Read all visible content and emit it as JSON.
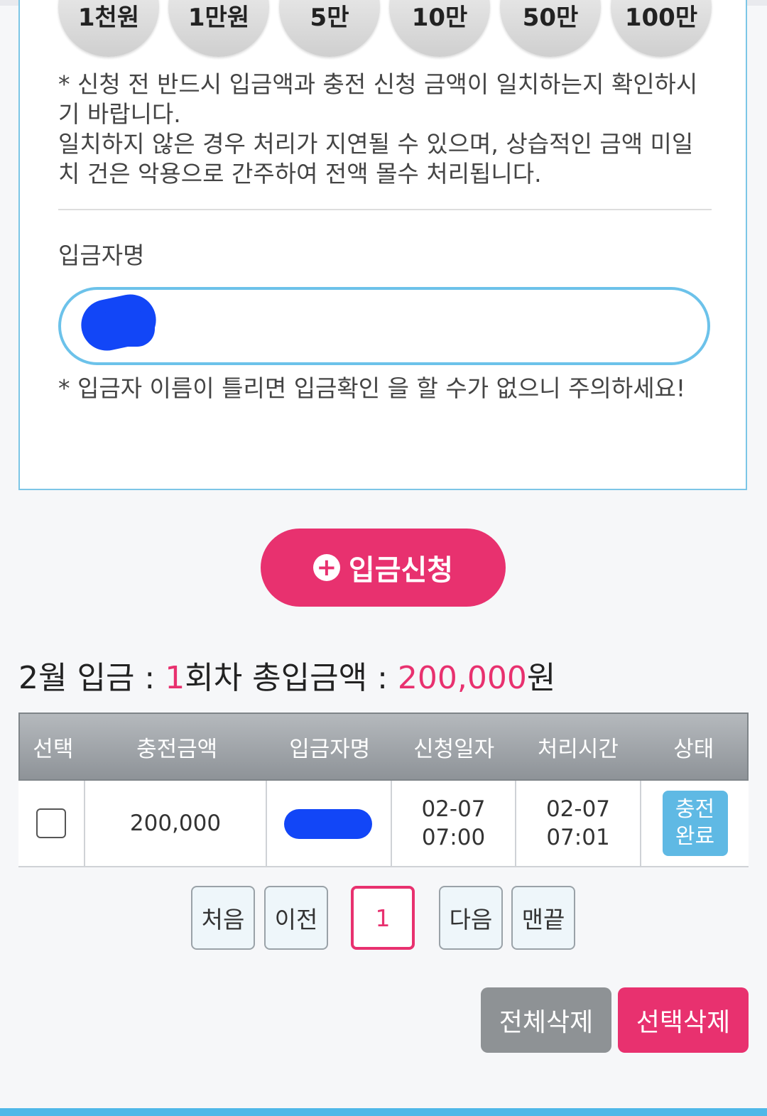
{
  "amount_buttons": [
    "1천원",
    "1만원",
    "5만",
    "10만",
    "50만",
    "100만"
  ],
  "notice": {
    "line1": "* 신청 전 반드시 입금액과 충전 신청 금액이 일치하는지 확인하시기 바랍니다.",
    "line2": "일치하지 않은 경우 처리가 지연될 수 있으며, 상습적인 금액 미일치 건은 악용으로 간주하여 전액 몰수 처리됩니다."
  },
  "depositor": {
    "label": "입금자명",
    "warning": "* 입금자 이름이 틀리면 입금확인 을 할 수가 없으니 주의하세요!"
  },
  "deposit_button": {
    "icon": "plus-circle-icon",
    "label": "입금신청"
  },
  "summary": {
    "month_prefix": "2월 입금 : ",
    "count": "1",
    "count_suffix": "회차 총입금액 : ",
    "total": "200,000",
    "total_suffix": "원"
  },
  "table": {
    "headers": [
      "선택",
      "충전금액",
      "입금자명",
      "신청일자",
      "처리시간",
      "상태"
    ],
    "rows": [
      {
        "amount": "200,000",
        "requested_date": "02-07",
        "requested_time": "07:00",
        "processed_date": "02-07",
        "processed_time": "07:01",
        "status_line1": "충전",
        "status_line2": "완료"
      }
    ]
  },
  "pagination": {
    "first": "처음",
    "prev": "이전",
    "current": "1",
    "next": "다음",
    "last": "맨끝"
  },
  "actions": {
    "delete_all": "전체삭제",
    "delete_selected": "선택삭제"
  },
  "colors": {
    "accent": "#e8316f",
    "info": "#5fb9e4",
    "border_blue": "#6cc2ea",
    "gray_button": "#8e9295"
  }
}
